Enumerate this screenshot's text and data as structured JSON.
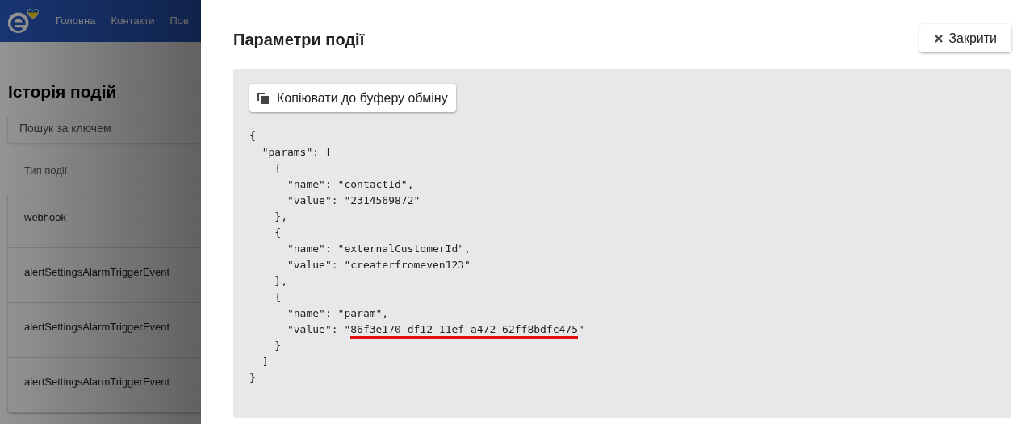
{
  "background_page": {
    "nav": [
      "Головна",
      "Контакти",
      "Пов"
    ],
    "title": "Історія подій",
    "search": {
      "placeholder": "Пошук за ключем"
    },
    "table": {
      "columns": [
        "Тип події"
      ],
      "rows": [
        [
          "webhook"
        ],
        [
          "alertSettingsAlarmTriggerEvent"
        ],
        [
          "alertSettingsAlarmTriggerEvent"
        ],
        [
          "alertSettingsAlarmTriggerEvent"
        ]
      ]
    }
  },
  "dialog": {
    "title": "Параметри події",
    "close_button": "Закрити",
    "copy_button": "Копіювати до буферу обміну",
    "code_lines": [
      {
        "kind": "plain",
        "text": "{"
      },
      {
        "kind": "plain",
        "text": "  \"params\": ["
      },
      {
        "kind": "plain",
        "text": "    {"
      },
      {
        "kind": "plain",
        "text": "      \"name\": \"contactId\","
      },
      {
        "kind": "plain",
        "text": "      \"value\": \"2314569872\""
      },
      {
        "kind": "plain",
        "text": "    },"
      },
      {
        "kind": "plain",
        "text": "    {"
      },
      {
        "kind": "plain",
        "text": "      \"name\": \"externalCustomerId\","
      },
      {
        "kind": "plain",
        "text": "      \"value\": \"createrfromeven123\""
      },
      {
        "kind": "plain",
        "text": "    },"
      },
      {
        "kind": "plain",
        "text": "    {"
      },
      {
        "kind": "plain",
        "text": "      \"name\": \"param\","
      },
      {
        "kind": "underlined",
        "before": "      \"value\": \"",
        "underlined": "86f3e170-df12-11ef-a472-62ff8bdfc475",
        "after": "\""
      },
      {
        "kind": "plain",
        "text": "    }"
      },
      {
        "kind": "plain",
        "text": "  ]"
      },
      {
        "kind": "plain",
        "text": "}"
      }
    ]
  }
}
